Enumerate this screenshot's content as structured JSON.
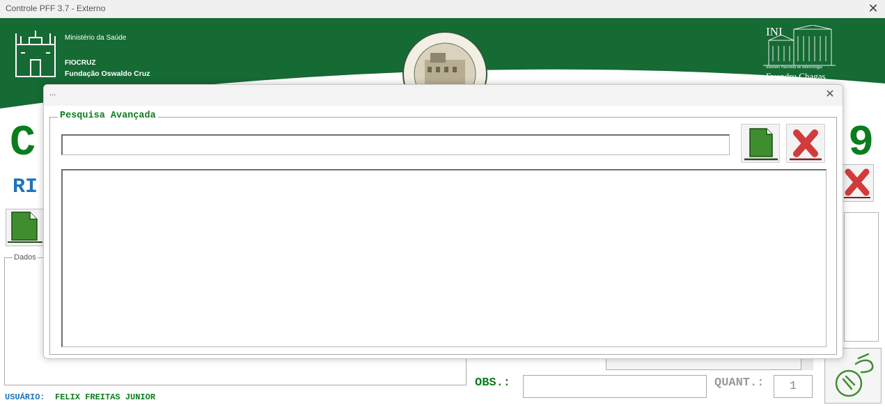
{
  "window": {
    "title": "Controle PFF 3.7 - Externo",
    "close_glyph": "✕"
  },
  "banner": {
    "ministry": "Ministério da Saúde",
    "fiocruz": "FIOCRUZ",
    "fundacao": "Fundação Oswaldo Cruz",
    "ini": "INI",
    "ini_full": "Instituto Nacional de Infectologia",
    "evandro": "Evandro Chagas",
    "color": "#166a34"
  },
  "background": {
    "heading_left": "C",
    "heading_right": "9",
    "ri_label": "RI",
    "dados_label": "Dados",
    "obs_label": "OBS.:",
    "quant_label": "QUANT.:",
    "quant_value": "1",
    "user_label": "USUÁRIO:",
    "user_name": "FELIX FREITAS JUNIOR"
  },
  "dialog": {
    "title": "...",
    "close_glyph": "✕",
    "frame_label": "Pesquisa Avançada",
    "search_value": "",
    "new_icon": "document-icon",
    "cancel_icon": "red-x-icon",
    "results": []
  }
}
